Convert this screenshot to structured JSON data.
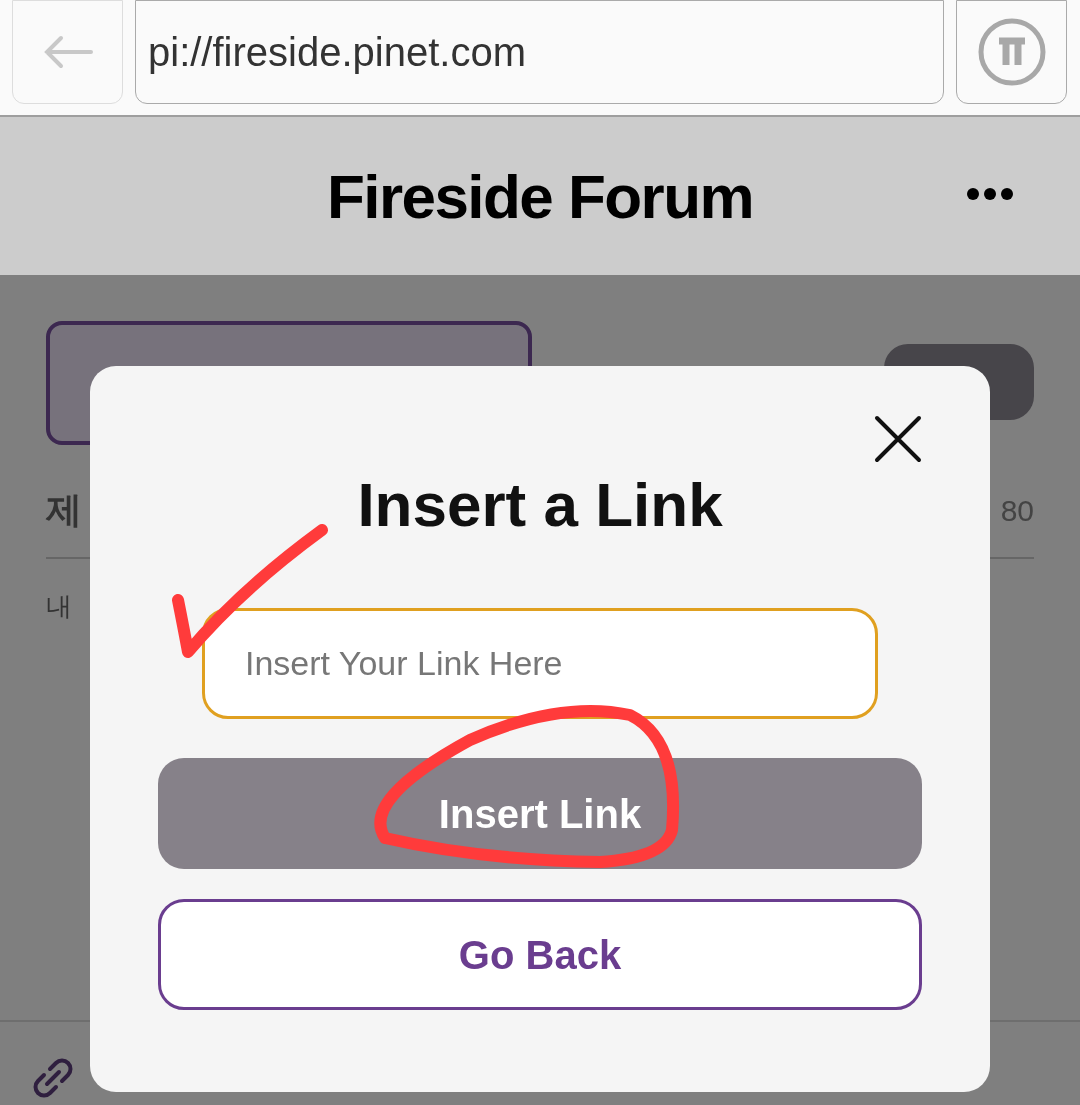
{
  "browser": {
    "url": "pi://fireside.pinet.com"
  },
  "header": {
    "title": "Fireside Forum"
  },
  "background": {
    "title_text": "제",
    "counter": "80",
    "content_text": "내"
  },
  "dialog": {
    "title": "Insert a Link",
    "input": {
      "placeholder": "Insert Your Link Here"
    },
    "buttons": [
      {
        "label": "Insert Link",
        "kind": "primary"
      },
      {
        "label": "Go Back",
        "kind": "outline"
      }
    ]
  }
}
